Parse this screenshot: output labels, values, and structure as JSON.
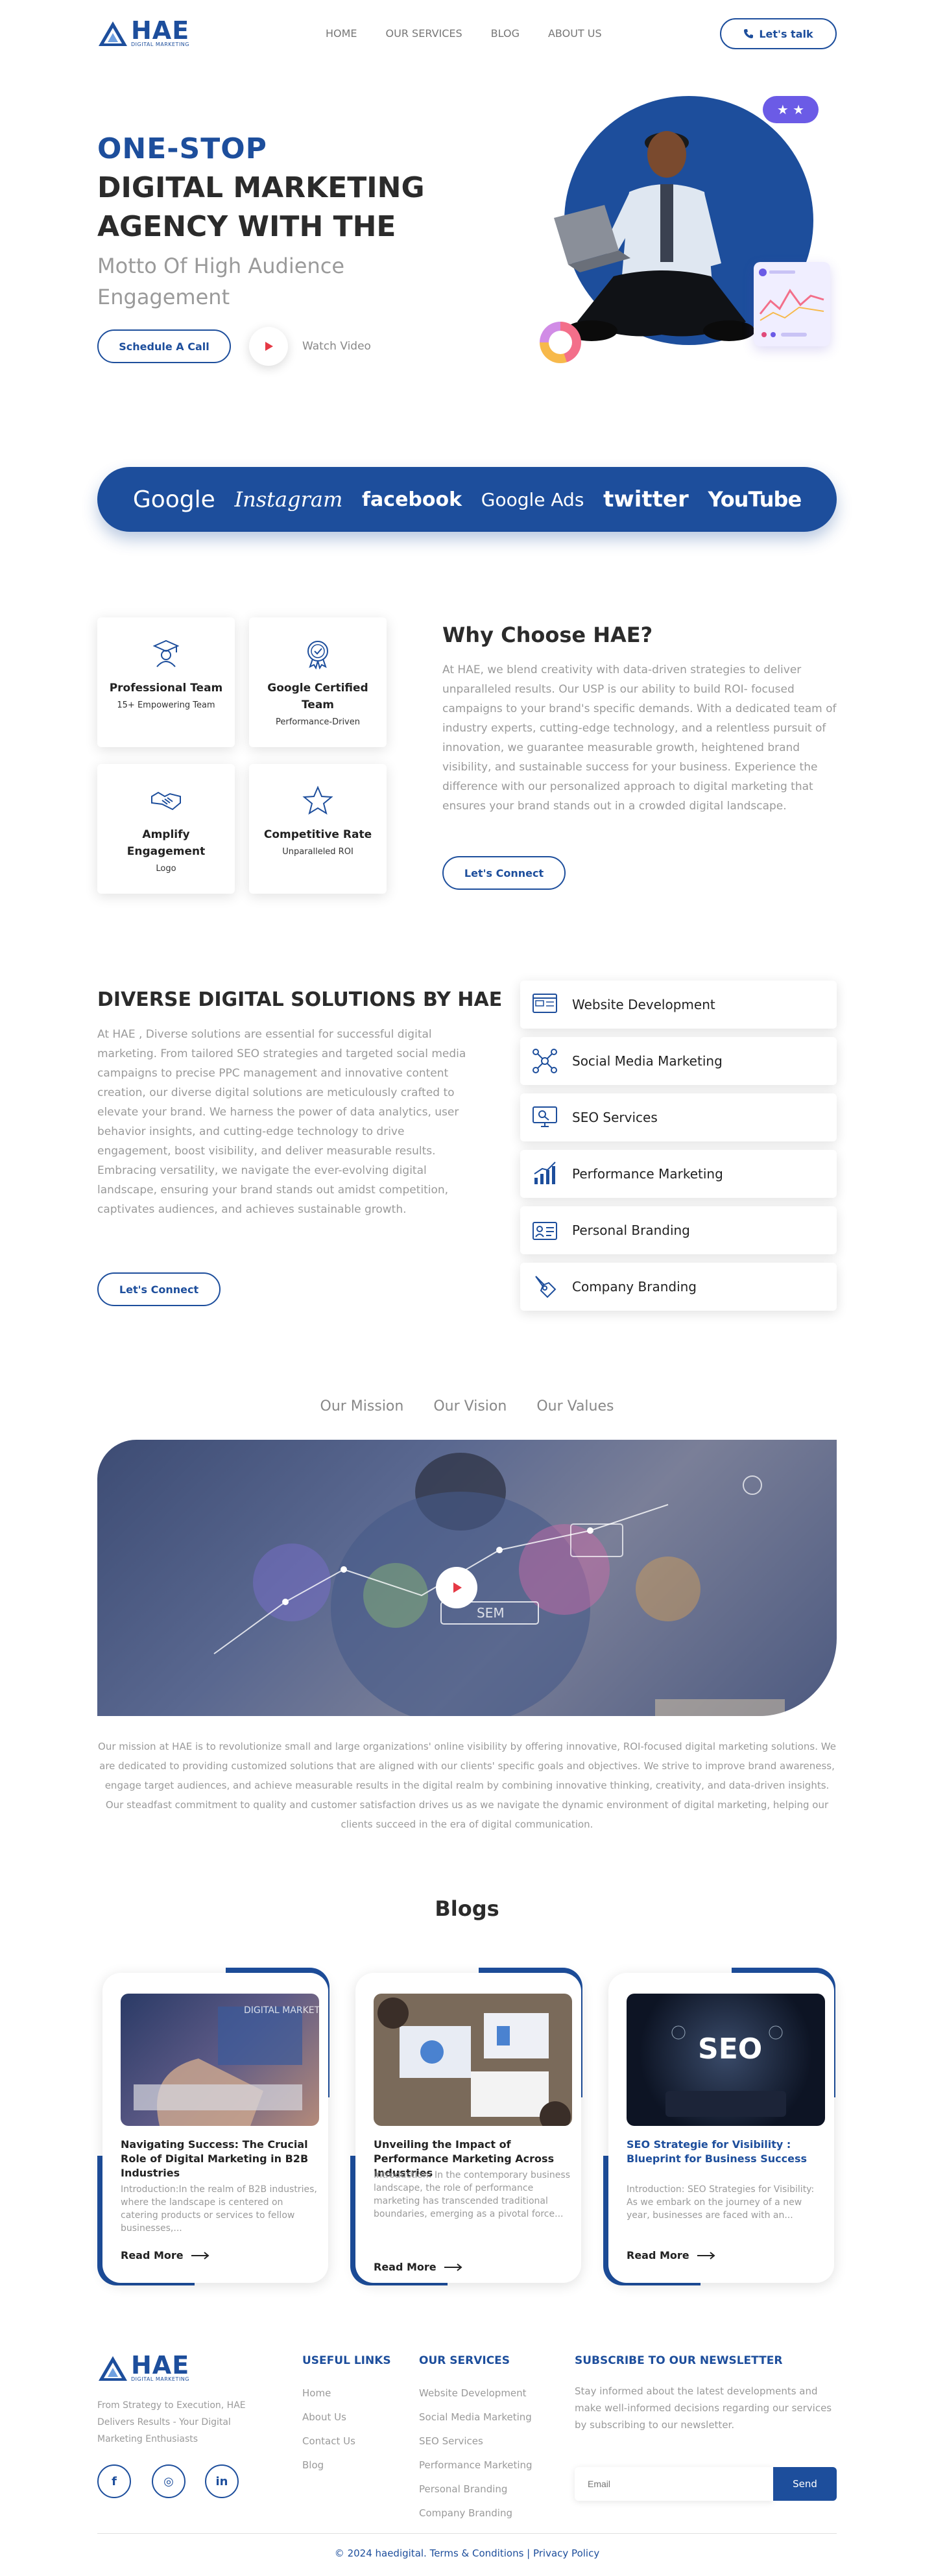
{
  "header": {
    "logo_text": "HAE",
    "logo_sub": "DIGITAL MARKETING",
    "nav": [
      "HOME",
      "OUR SERVICES",
      "BLOG",
      "ABOUT US"
    ],
    "cta": "Let's talk"
  },
  "hero": {
    "line1": "ONE-STOP",
    "line2": "DIGITAL MARKETING",
    "line3": "AGENCY WITH THE",
    "subtitle": "Motto Of High Audience Engagement",
    "schedule_btn": "Schedule A Call",
    "watch_video": "Watch Video",
    "stars": "★ ★"
  },
  "brands": [
    "Google",
    "Instagram",
    "facebook",
    "Google Ads",
    "twitter",
    "YouTube"
  ],
  "why": {
    "title": "Why Choose HAE?",
    "text": "At HAE, we blend creativity with data-driven strategies to deliver unparalleled results. Our USP is our ability to build ROI- focused campaigns to your brand's specific demands. With a dedicated team of industry experts, cutting-edge technology, and a relentless pursuit of innovation, we guarantee measurable growth, heightened brand visibility, and sustainable success for your business. Experience the difference with our personalized approach to digital marketing that ensures your brand stands out in a crowded digital landscape.",
    "button": "Let's Connect",
    "features": [
      {
        "title": "Professional Team",
        "sub": "15+ Empowering Team",
        "icon": "graduate-icon"
      },
      {
        "title": "Google Certified Team",
        "sub": "Performance-Driven",
        "icon": "certified-badge-icon"
      },
      {
        "title": "Amplify Engagement",
        "sub": "Logo",
        "icon": "handshake-icon"
      },
      {
        "title": "Competitive Rate",
        "sub": "Unparalleled ROI",
        "icon": "star-icon"
      }
    ]
  },
  "diverse": {
    "title": "DIVERSE DIGITAL SOLUTIONS BY HAE",
    "text": "At HAE , Diverse solutions are essential for successful digital marketing. From tailored SEO strategies and targeted social media campaigns to precise PPC management and innovative content creation, our diverse digital solutions are meticulously crafted to elevate your brand. We harness the power of data analytics, user behavior insights, and cutting-edge technology to drive engagement, boost visibility, and deliver measurable results. Embracing versatility, we navigate the ever-evolving digital landscape, ensuring your brand stands out amidst competition, captivates audiences, and achieves sustainable growth.",
    "button": "Let's Connect",
    "services": [
      {
        "label": "Website Development",
        "icon": "website-icon"
      },
      {
        "label": "Social Media Marketing",
        "icon": "network-icon"
      },
      {
        "label": "SEO Services",
        "icon": "seo-monitor-icon"
      },
      {
        "label": "Performance Marketing",
        "icon": "growth-chart-icon"
      },
      {
        "label": "Personal Branding",
        "icon": "id-card-icon"
      },
      {
        "label": "Company Branding",
        "icon": "pen-tool-icon"
      }
    ]
  },
  "mission": {
    "tabs": [
      "Our Mission",
      "Our Vision",
      "Our Values"
    ],
    "text": "Our mission at HAE is to revolutionize small and large organizations' online visibility by offering innovative, ROI-focused digital marketing solutions. We are dedicated to providing customized solutions that are aligned with our clients' specific goals and objectives. We strive to improve brand awareness, engage target audiences, and achieve measurable results in the digital realm by combining innovative thinking, creativity, and data-driven insights. Our steadfast commitment to quality and customer satisfaction drives us as we navigate the dynamic environment of digital marketing, helping our clients succeed in the era of digital communication.",
    "video_label": "SEM"
  },
  "blogs": {
    "title": "Blogs",
    "read_more": "Read More",
    "items": [
      {
        "title": "Navigating Success: The Crucial Role of Digital Marketing in B2B Industries",
        "excerpt": "Introduction:In the realm of B2B industries, where the landscape is centered on catering products or services to fellow businesses,...",
        "img_text": "DIGITAL MARKETING"
      },
      {
        "title": "Unveiling the Impact of Performance Marketing Across Industries",
        "excerpt": "Introduction: In the contemporary business landscape, the role of performance marketing has transcended traditional boundaries, emerging as a pivotal force...",
        "img_text": ""
      },
      {
        "title": "SEO Strategie for Visibility : Blueprint for Business Success",
        "excerpt": "Introduction: SEO Strategies for Visibility: As we embark on the journey of a new year, businesses are faced with an...",
        "img_text": "SEO"
      }
    ]
  },
  "footer": {
    "desc": "From Strategy to Execution, HAE Delivers Results - Your Digital Marketing Enthusiasts",
    "social": [
      "f",
      "◎",
      "in"
    ],
    "useful_title": "USEFUL LINKS",
    "useful": [
      "Home",
      "About Us",
      "Contact Us",
      "Blog"
    ],
    "services_title": "OUR SERVICES",
    "services": [
      "Website Development",
      "Social Media Marketing",
      "SEO Services",
      "Performance Marketing",
      "Personal Branding",
      "Company Branding"
    ],
    "news_title": "SUBSCRIBE TO OUR NEWSLETTER",
    "news_text": "Stay informed about the latest developments and make well-informed decisions regarding our services by subscribing to our newsletter.",
    "email_placeholder": "Email",
    "send": "Send",
    "copyright": "© 2024 haedigital. Terms & Conditions  |  Privacy Policy"
  },
  "colors": {
    "brand_blue": "#1d4e9c",
    "accent_purple": "#6b5be6"
  }
}
